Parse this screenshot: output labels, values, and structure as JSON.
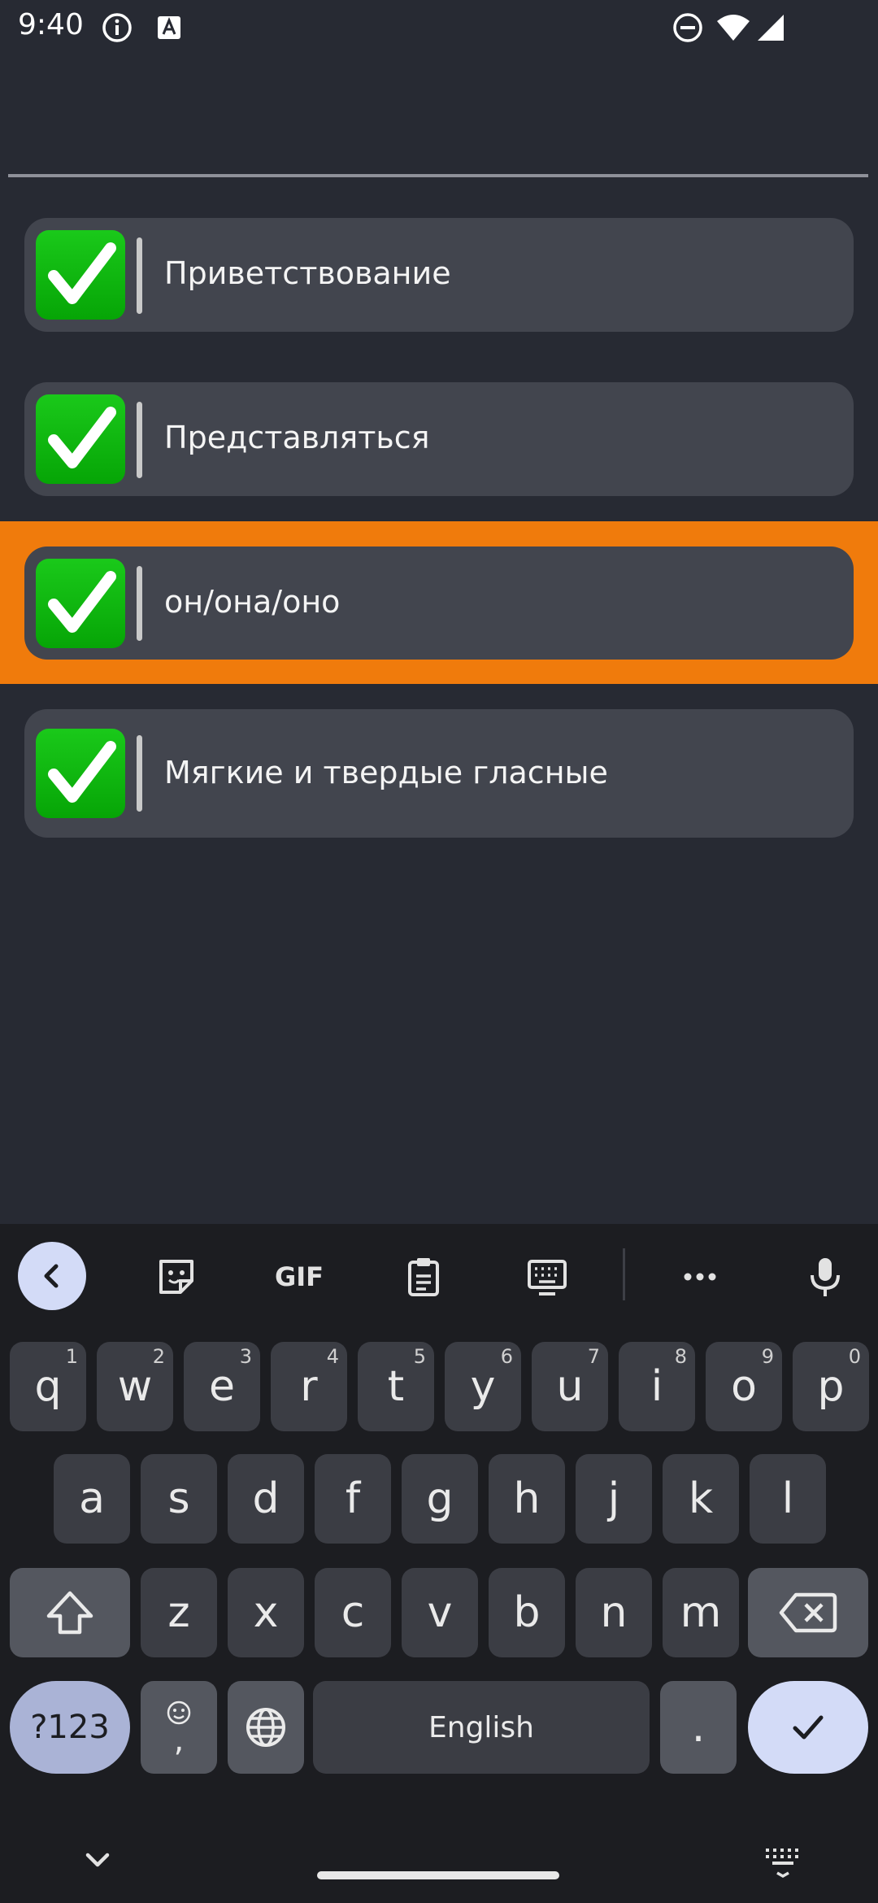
{
  "status_bar": {
    "time": "9:40",
    "icons": [
      "info-icon",
      "text-a-icon",
      "do-not-disturb-icon",
      "wifi-icon",
      "signal-icon"
    ]
  },
  "search": {
    "value": "",
    "placeholder": ""
  },
  "lessons": [
    {
      "label": "Приветствование",
      "check_icon": "check-mark-button-icon",
      "selected": false
    },
    {
      "label": "Представляться",
      "check_icon": "check-mark-button-icon",
      "selected": false
    },
    {
      "label": "он/она/оно",
      "check_icon": "check-mark-button-icon",
      "selected": true
    },
    {
      "label": "Мягкие и твердые гласные",
      "check_icon": "check-mark-button-icon",
      "selected": false
    }
  ],
  "keyboard": {
    "toolbar": {
      "gif_label": "GIF",
      "icons": [
        "chevron-left-icon",
        "sticker-icon",
        "gif-icon",
        "clipboard-icon",
        "keyboard-icon",
        "more-icon",
        "microphone-icon"
      ]
    },
    "row1": [
      {
        "key": "q",
        "hint": "1"
      },
      {
        "key": "w",
        "hint": "2"
      },
      {
        "key": "e",
        "hint": "3"
      },
      {
        "key": "r",
        "hint": "4"
      },
      {
        "key": "t",
        "hint": "5"
      },
      {
        "key": "y",
        "hint": "6"
      },
      {
        "key": "u",
        "hint": "7"
      },
      {
        "key": "i",
        "hint": "8"
      },
      {
        "key": "o",
        "hint": "9"
      },
      {
        "key": "p",
        "hint": "0"
      }
    ],
    "row2": [
      "a",
      "s",
      "d",
      "f",
      "g",
      "h",
      "j",
      "k",
      "l"
    ],
    "row3": [
      "z",
      "x",
      "c",
      "v",
      "b",
      "n",
      "m"
    ],
    "row4": {
      "symbols": "?123",
      "emoji_comma": ",",
      "space": "English",
      "period": "."
    }
  },
  "colors": {
    "background": "#272a33",
    "card": "#42454e",
    "selected_row": "#f07b0c",
    "check_green": "#10b810",
    "keyboard_bg": "#1c1d21",
    "key": "#3b3d44",
    "accent_key": "#d3dbf7"
  }
}
